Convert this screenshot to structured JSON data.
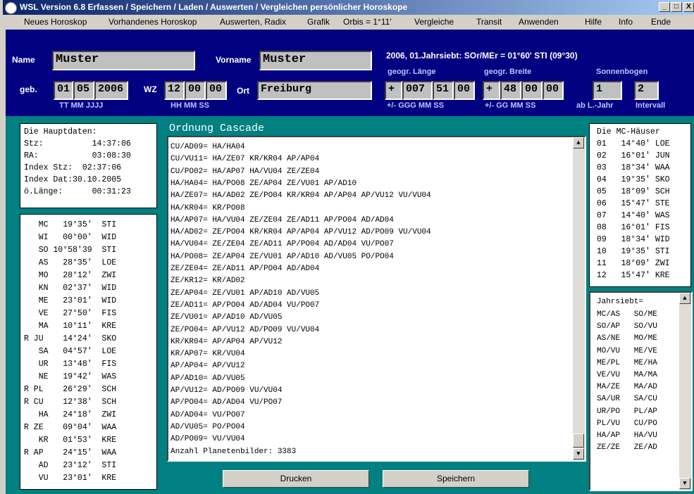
{
  "window": {
    "title": "WSL Version 6.8    Erfassen / Speichern / Laden / Auswerten / Vergleichen persönlicher Horoskope",
    "min": "_",
    "max": "□",
    "close": "X"
  },
  "menu": [
    "Neues Horoskop",
    "Vorhandenes Horoskop",
    "Auswerten, Radix",
    "Grafik",
    "Orbis = 1°11'",
    "Vergleiche",
    "Transit",
    "Anwenden",
    "Hilfe",
    "Info",
    "Ende"
  ],
  "form": {
    "name_label": "Name",
    "name_value": "Muster",
    "vorname_label": "Vorname",
    "vorname_value": "Muster",
    "geb_label": "geb.",
    "geb_tt": "01",
    "geb_mm": "05",
    "geb_jjjj": "2006",
    "geb_sub": "TT MM  JJJJ",
    "wz_label": "WZ",
    "wz_hh": "12",
    "wz_mm": "00",
    "wz_ss": "00",
    "wz_sub": "HH MM SS",
    "ort_label": "Ort",
    "ort_value": "Freiburg",
    "info_line": "2006, 01.Jahrsiebt: SOr/MEr = 01°60' STI (09°30)",
    "laenge_label": "geogr. Länge",
    "laenge_sign": "+",
    "laenge_ggg": "007",
    "laenge_mm": "51",
    "laenge_ss": "00",
    "laenge_sub": "+/-  GGG  MM  SS",
    "breite_label": "geogr. Breite",
    "breite_sign": "+",
    "breite_gg": "48",
    "breite_mm": "00",
    "breite_ss": "00",
    "breite_sub": "+/-  GG  MM  SS",
    "sonnenbogen_label": "Sonnenbogen",
    "sb_ab": "1",
    "sb_int": "2",
    "sb_sub1": "ab L.-Jahr",
    "sb_sub2": "Intervall"
  },
  "hauptdaten": {
    "title": "Die Hauptdaten:",
    "rows": [
      "Stz:          14:37:06",
      "RA:           03:08:30",
      "Index Stz:  02:37:06",
      "Index Dat:30.10.2005",
      "ö.Länge:      00:31:23"
    ]
  },
  "planets": [
    "   MC   19°35'  STI",
    "   WI   00°00'  WID",
    "   SO 10°58'39  STI",
    "   AS   28°35'  LOE",
    "   MO   28°12'  ZWI",
    "   KN   02°37'  WID",
    "   ME   23°01'  WID",
    "   VE   27°50'  FIS",
    "   MA   10°11'  KRE",
    "R JU    14°24'  SKO",
    "   SA   04°57'  LOE",
    "   UR   13°48'  FIS",
    "   NE   19°42'  WAS",
    "R PL    26°29'  SCH",
    "R CU    12°38'  SCH",
    "   HA   24°18'  ZWI",
    "R ZE    09°04'  WAA",
    "   KR   01°53'  KRE",
    "R AP    24°15'  WAA",
    "   AD   23°12'  STI",
    "   VU   23°01'  KRE"
  ],
  "cascade": {
    "heading": "Ordnung Cascade",
    "lines": [
      "CU/AD09= HA/HA04",
      "CU/VU11= HA/ZE07 KR/KR04 AP/AP04",
      "CU/PO02= HA/AP07 HA/VU04 ZE/ZE04",
      "HA/HA04= HA/PO08 ZE/AP04 ZE/VU01 AP/AD10",
      "HA/ZE07= HA/AD02 ZE/PO04 KR/KR04 AP/AP04 AP/VU12 VU/VU04",
      "HA/KR04= KR/PO08",
      "HA/AP07= HA/VU04 ZE/ZE04 ZE/AD11 AP/PO04 AD/AD04",
      "HA/AD02= ZE/PO04 KR/KR04 AP/AP04 AP/VU12 AD/PO09 VU/VU04",
      "HA/VU04= ZE/ZE04 ZE/AD11 AP/PO04 AD/AD04 VU/PO07",
      "HA/PO08= ZE/AP04 ZE/VU01 AP/AD10 AD/VU05 PO/PO04",
      "ZE/ZE04= ZE/AD11 AP/PO04 AD/AD04",
      "ZE/KR12= KR/AD02",
      "ZE/AP04= ZE/VU01 AP/AD10 AD/VU05",
      "ZE/AD11= AP/PO04 AD/AD04 VU/PO07",
      "ZE/VU01= AP/AD10 AD/VU05",
      "ZE/PO04= AP/VU12 AD/PO09 VU/VU04",
      "KR/KR04= AP/AP04 AP/VU12",
      "KR/AP07= KR/VU04",
      "AP/AP04= AP/VU12",
      "AP/AD10= AD/VU05",
      "AP/VU12= AD/PO09 VU/VU04",
      "AP/PO04= AD/AD04 VU/PO07",
      "AD/AD04= VU/PO07",
      "AD/VU05= PO/PO04",
      "AD/PO09= VU/VU04",
      "Anzahl Planetenbilder: 3383"
    ]
  },
  "mc_haeuser": {
    "title": "Die MC-Häuser",
    "rows": [
      "01   14°40' LOE",
      "02   16°01' JUN",
      "03   18°34' WAA",
      "04   19°35' SKO",
      "05   18°09' SCH",
      "06   15°47' STE",
      "07   14°40' WAS",
      "08   16°01' FIS",
      "09   18°34' WID",
      "10   19°35' STI",
      "11   18°09' ZWI",
      "12   15°47' KRE"
    ]
  },
  "jahrsiebt": {
    "title": "Jahrsiebt=",
    "rows": [
      "MC/AS   SO/ME",
      "SO/AP   SO/VU",
      "AS/NE   MO/ME",
      "MO/VU   ME/VE",
      "ME/PL   ME/HA",
      "VE/VU   MA/MA",
      "MA/ZE   MA/AD",
      "SA/UR   SA/CU",
      "UR/PO   PL/AP",
      "PL/VU   CU/PO",
      "HA/AP   HA/VU",
      "ZE/ZE   ZE/AD"
    ]
  },
  "buttons": {
    "drucken": "Drucken",
    "speichern": "Speichern"
  }
}
